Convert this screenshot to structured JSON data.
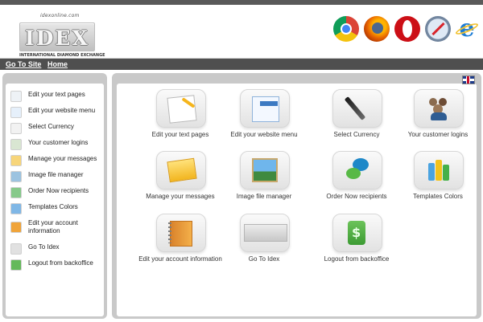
{
  "logo": {
    "url_text": "idexonline.com",
    "mark_text": "IDEX",
    "tagline": "INTERNATIONAL DIAMOND EXCHANGE"
  },
  "browsers": [
    {
      "icon": "chrome-icon"
    },
    {
      "icon": "firefox-icon"
    },
    {
      "icon": "opera-icon"
    },
    {
      "icon": "safari-icon"
    },
    {
      "icon": "internet-explorer-icon"
    }
  ],
  "nav": {
    "go_to_site": "Go To Site",
    "home": "Home"
  },
  "sidebar": {
    "items": [
      {
        "label": "Edit your text pages",
        "icon": "text-pages-icon"
      },
      {
        "label": "Edit your website menu",
        "icon": "website-menu-icon"
      },
      {
        "label": "Select Currency",
        "icon": "currency-pen-icon"
      },
      {
        "label": "Your customer logins",
        "icon": "customers-icon"
      },
      {
        "label": "Manage your messages",
        "icon": "envelope-icon"
      },
      {
        "label": "Image file manager",
        "icon": "image-icon"
      },
      {
        "label": "Order Now recipients",
        "icon": "chat-bubbles-icon"
      },
      {
        "label": "Templates Colors",
        "icon": "colors-icon"
      },
      {
        "label": "Edit your account information",
        "icon": "account-book-icon"
      },
      {
        "label": "Go To Idex",
        "icon": "idex-logo-icon"
      },
      {
        "label": "Logout from backoffice",
        "icon": "logout-icon"
      }
    ]
  },
  "tiles": [
    {
      "label": "Edit your text pages"
    },
    {
      "label": "Edit your website menu"
    },
    {
      "label": "Select Currency"
    },
    {
      "label": "Your customer logins"
    },
    {
      "label": "Manage your messages"
    },
    {
      "label": "Image file manager"
    },
    {
      "label": "Order Now recipients"
    },
    {
      "label": "Templates Colors"
    },
    {
      "label": "Edit your account information"
    },
    {
      "label": "Go To Idex"
    },
    {
      "label": "Logout from backoffice"
    }
  ],
  "colors": {
    "accent_dark": "#4f4f4f",
    "panel_gray": "#c9c9c9"
  }
}
